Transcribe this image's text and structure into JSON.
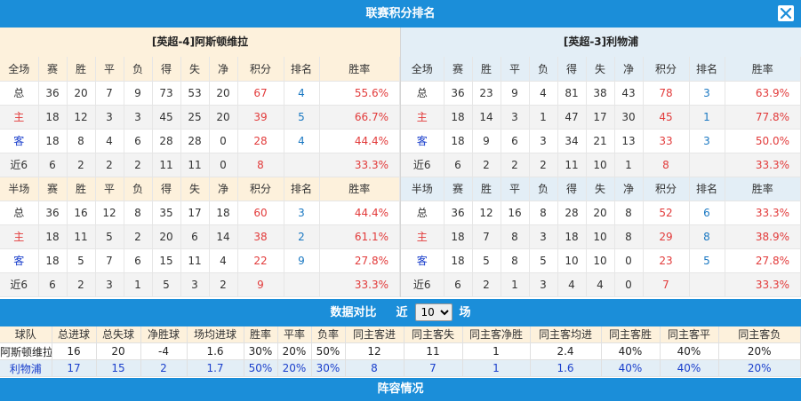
{
  "window": {
    "title": "联赛积分排名",
    "close_icon": "close-icon"
  },
  "columns": [
    "赛",
    "胜",
    "平",
    "负",
    "得",
    "失",
    "净",
    "积分",
    "排名",
    "胜率"
  ],
  "home_team": {
    "title": "[英超-4]阿斯顿维拉",
    "full": {
      "label": "全场",
      "rows": [
        {
          "label": "总",
          "type": "total",
          "vals": [
            "36",
            "20",
            "7",
            "9",
            "73",
            "53",
            "20"
          ],
          "pts": "67",
          "rank": "4",
          "rate": "55.6%"
        },
        {
          "label": "主",
          "type": "home",
          "vals": [
            "18",
            "12",
            "3",
            "3",
            "45",
            "25",
            "20"
          ],
          "pts": "39",
          "rank": "5",
          "rate": "66.7%"
        },
        {
          "label": "客",
          "type": "away",
          "vals": [
            "18",
            "8",
            "4",
            "6",
            "28",
            "28",
            "0"
          ],
          "pts": "28",
          "rank": "4",
          "rate": "44.4%"
        },
        {
          "label": "近6",
          "type": "recent",
          "vals": [
            "6",
            "2",
            "2",
            "2",
            "11",
            "11",
            "0"
          ],
          "pts": "8",
          "rank": "",
          "rate": "33.3%"
        }
      ]
    },
    "half": {
      "label": "半场",
      "rows": [
        {
          "label": "总",
          "type": "total",
          "vals": [
            "36",
            "16",
            "12",
            "8",
            "35",
            "17",
            "18"
          ],
          "pts": "60",
          "rank": "3",
          "rate": "44.4%"
        },
        {
          "label": "主",
          "type": "home",
          "vals": [
            "18",
            "11",
            "5",
            "2",
            "20",
            "6",
            "14"
          ],
          "pts": "38",
          "rank": "2",
          "rate": "61.1%"
        },
        {
          "label": "客",
          "type": "away",
          "vals": [
            "18",
            "5",
            "7",
            "6",
            "15",
            "11",
            "4"
          ],
          "pts": "22",
          "rank": "9",
          "rate": "27.8%"
        },
        {
          "label": "近6",
          "type": "recent",
          "vals": [
            "6",
            "2",
            "3",
            "1",
            "5",
            "3",
            "2"
          ],
          "pts": "9",
          "rank": "",
          "rate": "33.3%"
        }
      ]
    }
  },
  "away_team": {
    "title": "[英超-3]利物浦",
    "full": {
      "label": "全场",
      "rows": [
        {
          "label": "总",
          "type": "total",
          "vals": [
            "36",
            "23",
            "9",
            "4",
            "81",
            "38",
            "43"
          ],
          "pts": "78",
          "rank": "3",
          "rate": "63.9%"
        },
        {
          "label": "主",
          "type": "home",
          "vals": [
            "18",
            "14",
            "3",
            "1",
            "47",
            "17",
            "30"
          ],
          "pts": "45",
          "rank": "1",
          "rate": "77.8%"
        },
        {
          "label": "客",
          "type": "away",
          "vals": [
            "18",
            "9",
            "6",
            "3",
            "34",
            "21",
            "13"
          ],
          "pts": "33",
          "rank": "3",
          "rate": "50.0%"
        },
        {
          "label": "近6",
          "type": "recent",
          "vals": [
            "6",
            "2",
            "2",
            "2",
            "11",
            "10",
            "1"
          ],
          "pts": "8",
          "rank": "",
          "rate": "33.3%"
        }
      ]
    },
    "half": {
      "label": "半场",
      "rows": [
        {
          "label": "总",
          "type": "total",
          "vals": [
            "36",
            "12",
            "16",
            "8",
            "28",
            "20",
            "8"
          ],
          "pts": "52",
          "rank": "6",
          "rate": "33.3%"
        },
        {
          "label": "主",
          "type": "home",
          "vals": [
            "18",
            "7",
            "8",
            "3",
            "18",
            "10",
            "8"
          ],
          "pts": "29",
          "rank": "8",
          "rate": "38.9%"
        },
        {
          "label": "客",
          "type": "away",
          "vals": [
            "18",
            "5",
            "8",
            "5",
            "10",
            "10",
            "0"
          ],
          "pts": "23",
          "rank": "5",
          "rate": "27.8%"
        },
        {
          "label": "近6",
          "type": "recent",
          "vals": [
            "6",
            "2",
            "1",
            "3",
            "4",
            "4",
            "0"
          ],
          "pts": "7",
          "rank": "",
          "rate": "33.3%"
        }
      ]
    }
  },
  "compare": {
    "title": "数据对比",
    "prefix": "近",
    "selected": "10",
    "options": [
      "10"
    ],
    "suffix": "场",
    "headers": [
      "球队",
      "总进球",
      "总失球",
      "净胜球",
      "场均进球",
      "胜率",
      "平率",
      "负率",
      "同主客进",
      "同主客失",
      "同主客净胜",
      "同主客均进",
      "同主客胜",
      "同主客平",
      "同主客负"
    ],
    "rows": [
      [
        "阿斯顿维拉",
        "16",
        "20",
        "-4",
        "1.6",
        "30%",
        "20%",
        "50%",
        "12",
        "11",
        "1",
        "2.4",
        "40%",
        "40%",
        "20%"
      ],
      [
        "利物浦",
        "17",
        "15",
        "2",
        "1.7",
        "50%",
        "20%",
        "30%",
        "8",
        "7",
        "1",
        "1.6",
        "40%",
        "40%",
        "20%"
      ]
    ]
  },
  "lineup": {
    "title": "阵容情况"
  },
  "colors": {
    "header_blue": "#1b8ed9",
    "home_red": "#e23b3b",
    "rank_blue": "#1a78c2",
    "away_blue": "#1a3fcc",
    "home_bg": "#fdf1dc",
    "away_bg": "#e3eef6"
  }
}
